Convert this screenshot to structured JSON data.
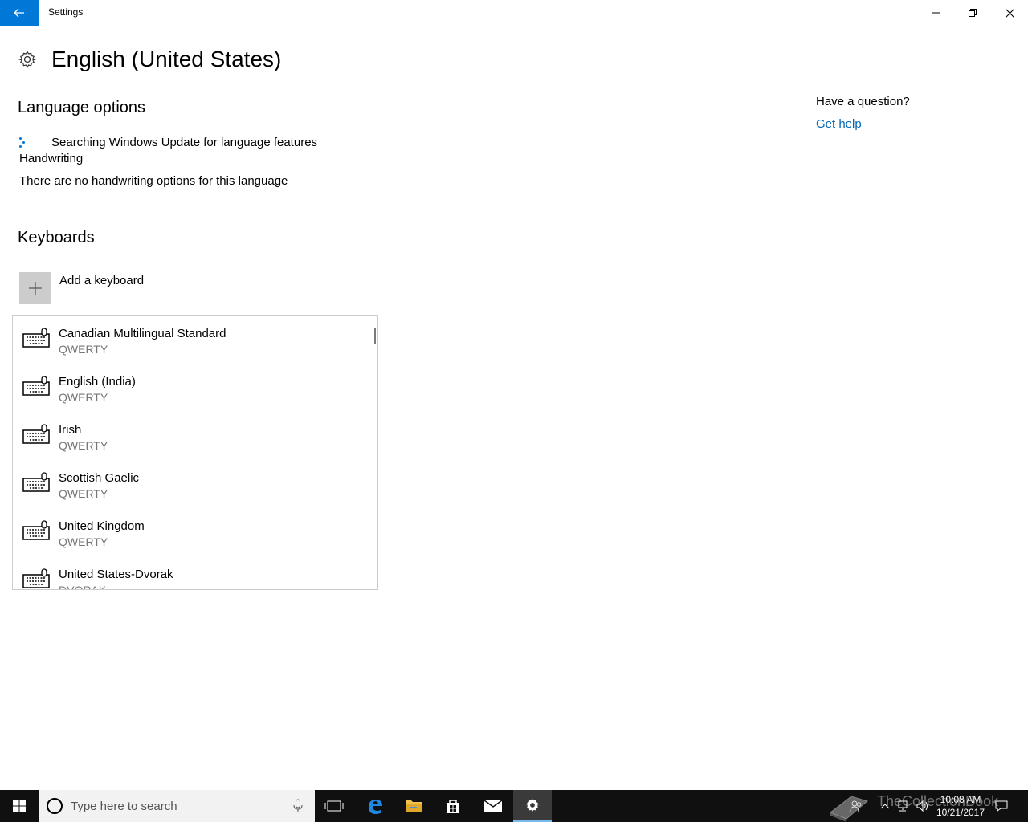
{
  "window": {
    "title": "Settings"
  },
  "page": {
    "title": "English (United States)"
  },
  "language_options": {
    "title": "Language options",
    "searching_text": "Searching Windows Update for language features",
    "handwriting_label": "Handwriting",
    "handwriting_text": "There are no handwriting options for this language"
  },
  "keyboards": {
    "title": "Keyboards",
    "add_label": "Add a keyboard",
    "items": [
      {
        "name": "Canadian Multilingual Standard",
        "layout": "QWERTY"
      },
      {
        "name": "English (India)",
        "layout": "QWERTY"
      },
      {
        "name": "Irish",
        "layout": "QWERTY"
      },
      {
        "name": "Scottish Gaelic",
        "layout": "QWERTY"
      },
      {
        "name": "United Kingdom",
        "layout": "QWERTY"
      },
      {
        "name": "United States-Dvorak",
        "layout": "DVORAK"
      }
    ]
  },
  "help": {
    "question": "Have a question?",
    "link": "Get help"
  },
  "taskbar": {
    "search_placeholder": "Type here to search",
    "time": "10:08 AM",
    "date": "10/21/2017"
  },
  "watermark": {
    "text": "TheCollectionBook"
  },
  "colors": {
    "accent": "#0078d7",
    "link": "#0067b8",
    "taskbar": "#101010"
  }
}
